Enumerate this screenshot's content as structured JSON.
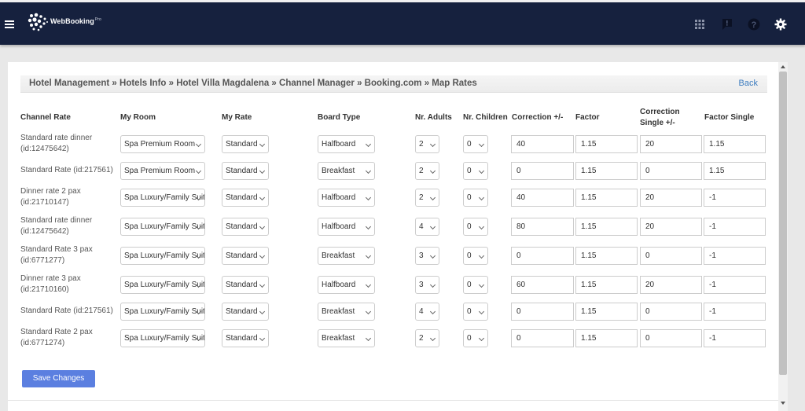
{
  "app": {
    "brand": "WebBooking",
    "brand_mark": "Pro"
  },
  "breadcrumb": "Hotel Management » Hotels Info » Hotel Villa Magdalena » Channel Manager » Booking.com » Map Rates",
  "back_label": "Back",
  "headers": {
    "channel_rate": "Channel Rate",
    "my_room": "My Room",
    "my_rate": "My Rate",
    "board_type": "Board Type",
    "nr_adults": "Nr. Adults",
    "nr_children": "Nr. Children",
    "correction": "Correction +/-",
    "factor": "Factor",
    "correction_single": "Correction Single +/-",
    "factor_single": "Factor Single"
  },
  "rows": [
    {
      "channel_rate": "Standard rate dinner (id:12475642)",
      "room": "Spa Premium Room",
      "rate": "Standard",
      "board": "Halfboard",
      "adults": "2",
      "children": "0",
      "correction": "40",
      "factor": "1.15",
      "correction_single": "20",
      "factor_single": "1.15"
    },
    {
      "channel_rate": "Standard Rate (id:217561)",
      "room": "Spa Premium Room",
      "rate": "Standard",
      "board": "Breakfast",
      "adults": "2",
      "children": "0",
      "correction": "0",
      "factor": "1.15",
      "correction_single": "0",
      "factor_single": "1.15"
    },
    {
      "channel_rate": "Dinner rate 2 pax (id:21710147)",
      "room": "Spa Luxury/Family Suite",
      "rate": "Standard",
      "board": "Halfboard",
      "adults": "2",
      "children": "0",
      "correction": "40",
      "factor": "1.15",
      "correction_single": "20",
      "factor_single": "-1"
    },
    {
      "channel_rate": "Standard rate dinner (id:12475642)",
      "room": "Spa Luxury/Family Suite",
      "rate": "Standard",
      "board": "Halfboard",
      "adults": "4",
      "children": "0",
      "correction": "80",
      "factor": "1.15",
      "correction_single": "20",
      "factor_single": "-1"
    },
    {
      "channel_rate": "Standard Rate 3 pax (id:6771277)",
      "room": "Spa Luxury/Family Suite",
      "rate": "Standard",
      "board": "Breakfast",
      "adults": "3",
      "children": "0",
      "correction": "0",
      "factor": "1.15",
      "correction_single": "0",
      "factor_single": "-1"
    },
    {
      "channel_rate": "Dinner rate 3 pax (id:21710160)",
      "room": "Spa Luxury/Family Suite",
      "rate": "Standard",
      "board": "Halfboard",
      "adults": "3",
      "children": "0",
      "correction": "60",
      "factor": "1.15",
      "correction_single": "20",
      "factor_single": "-1"
    },
    {
      "channel_rate": "Standard Rate (id:217561)",
      "room": "Spa Luxury/Family Suite",
      "rate": "Standard",
      "board": "Breakfast",
      "adults": "4",
      "children": "0",
      "correction": "0",
      "factor": "1.15",
      "correction_single": "0",
      "factor_single": "-1"
    },
    {
      "channel_rate": "Standard Rate 2 pax (id:6771274)",
      "room": "Spa Luxury/Family Suite",
      "rate": "Standard",
      "board": "Breakfast",
      "adults": "2",
      "children": "0",
      "correction": "0",
      "factor": "1.15",
      "correction_single": "0",
      "factor_single": "-1"
    }
  ],
  "save_label": "Save Changes",
  "icons": {
    "menu": "hamburger-menu-icon",
    "apps": "grid-apps-icon",
    "feedback": "flag-feedback-icon",
    "help": "help-icon",
    "settings": "gear-icon"
  },
  "colors": {
    "topbar": "#16213e",
    "button": "#5b7fe0",
    "link": "#3b7bbf"
  }
}
